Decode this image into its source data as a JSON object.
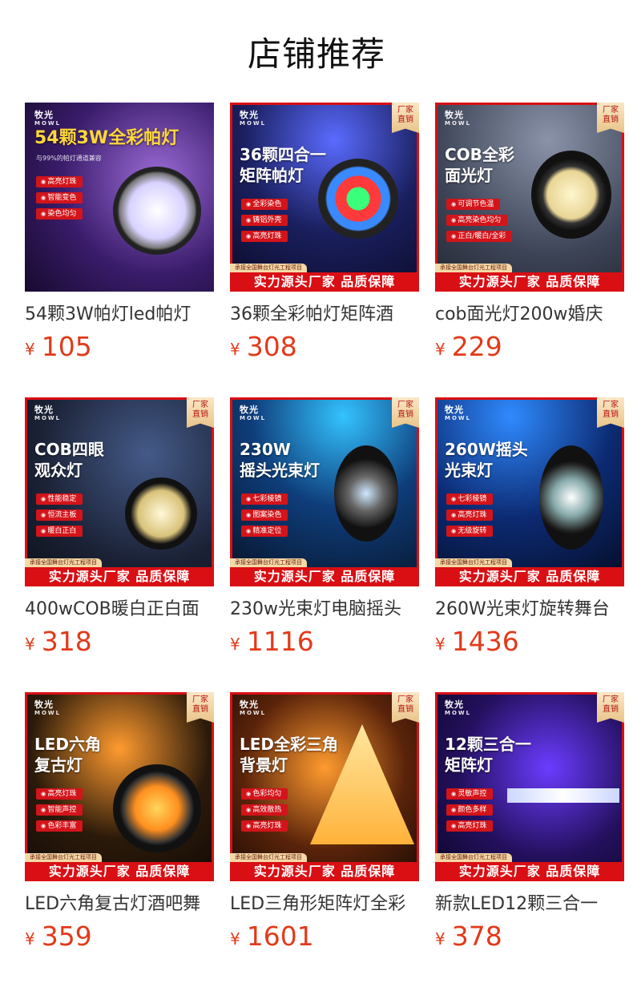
{
  "section_title": "店铺推荐",
  "badge_text": "厂家直销",
  "bottom_bar": "实力源头厂家 品质保障",
  "strip_text": "承接全国舞台灯光工程项目",
  "currency": "¥",
  "accent_color": "#d90f14",
  "price_color": "#e23a1a",
  "products": [
    {
      "name": "54颗3W帕灯led帕灯",
      "price": "105",
      "headline": "54颗3W全彩帕灯",
      "sub": "与99%的帕灯通道兼容",
      "features": [
        "高亮灯珠",
        "智能变色",
        "染色均匀"
      ],
      "logo": "牧光"
    },
    {
      "name": "36颗全彩帕灯矩阵酒",
      "price": "308",
      "headline": "36颗四合一\n矩阵帕灯",
      "features": [
        "全彩染色",
        "铸铝外壳",
        "高亮灯珠"
      ],
      "logo": "牧光"
    },
    {
      "name": "cob面光灯200w婚庆",
      "price": "229",
      "headline": "COB全彩\n面光灯",
      "features": [
        "可调节色温",
        "高亮染色均匀",
        "正白/暖白/全彩"
      ],
      "logo": "牧光"
    },
    {
      "name": "400wCOB暖白正白面",
      "price": "318",
      "headline": "COB四眼\n观众灯",
      "features": [
        "性能稳定",
        "恒流主板",
        "暖白正白"
      ],
      "logo": "牧光"
    },
    {
      "name": "230w光束灯电脑摇头",
      "price": "1116",
      "headline": "230W\n摇头光束灯",
      "features": [
        "七彩棱镜",
        "图案染色",
        "精准定位"
      ],
      "logo": "牧光"
    },
    {
      "name": "260W光束灯旋转舞台",
      "price": "1436",
      "headline": "260W摇头\n光束灯",
      "features": [
        "七彩棱镜",
        "高亮灯珠",
        "无级旋转"
      ],
      "logo": "牧光"
    },
    {
      "name": "LED六角复古灯酒吧舞",
      "price": "359",
      "headline": "LED六角\n复古灯",
      "features": [
        "高亮灯珠",
        "智能声控",
        "色彩丰富"
      ],
      "logo": "牧光"
    },
    {
      "name": "LED三角形矩阵灯全彩",
      "price": "1601",
      "headline": "LED全彩三角\n背景灯",
      "features": [
        "色彩均匀",
        "高效散热",
        "高亮灯珠"
      ],
      "logo": "牧光"
    },
    {
      "name": "新款LED12颗三合一",
      "price": "378",
      "headline": "12颗三合一\n矩阵灯",
      "features": [
        "灵敏声控",
        "颜色多样",
        "高亮灯珠"
      ],
      "logo": "牧光"
    }
  ]
}
